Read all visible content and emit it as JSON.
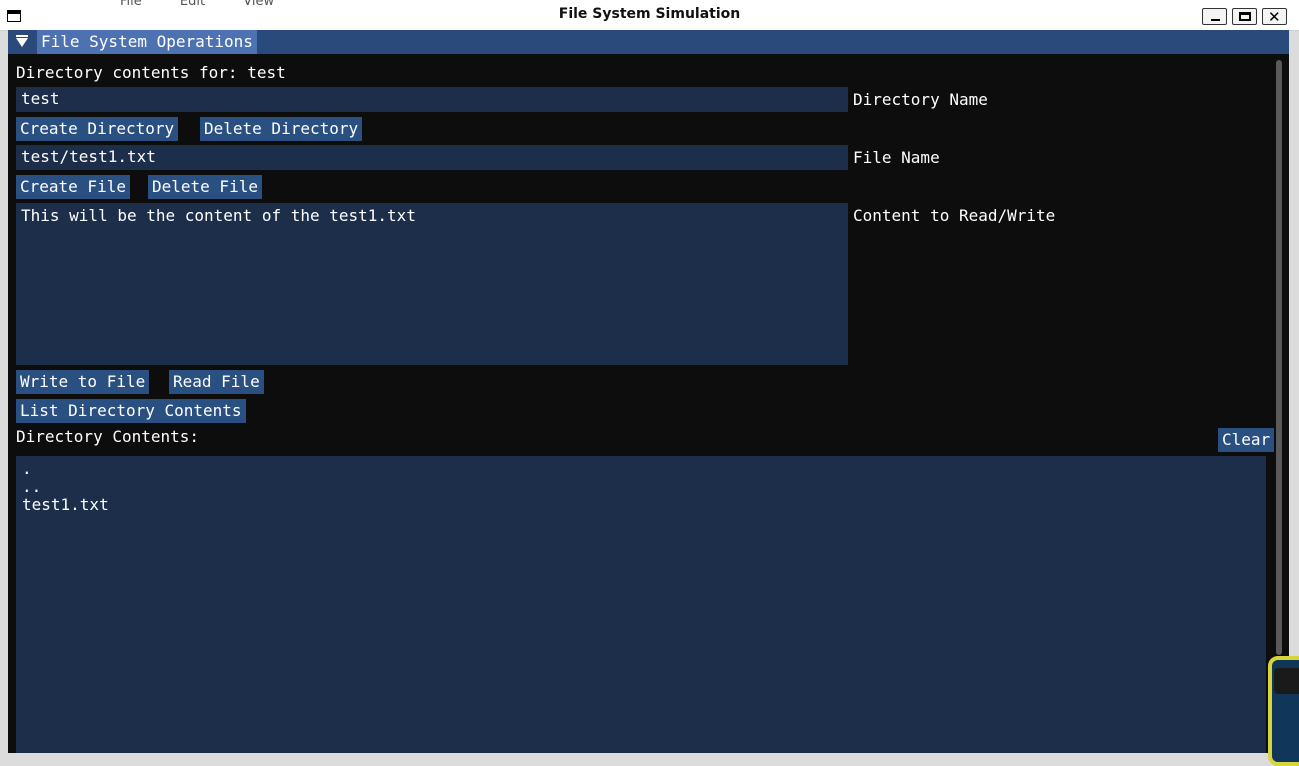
{
  "window": {
    "title": "File System Simulation",
    "background_menu": [
      "File",
      "Edit",
      "View"
    ]
  },
  "panel": {
    "header": "File System Operations"
  },
  "directory_label": "Directory contents for: test",
  "directory_input": {
    "value": "test",
    "label": "Directory Name"
  },
  "directory_buttons": {
    "create": "Create Directory",
    "delete": "Delete Directory"
  },
  "file_input": {
    "value": "test/test1.txt",
    "label": "File Name"
  },
  "file_buttons": {
    "create": "Create File",
    "delete": "Delete File"
  },
  "content_input": {
    "value": "This will be the content of the test1.txt",
    "label": "Content to Read/Write"
  },
  "io_buttons": {
    "write": "Write to File",
    "read": "Read File"
  },
  "list_button": "List Directory Contents",
  "contents_label": "Directory Contents:",
  "clear_button": "Clear",
  "contents_lines": [
    ".",
    "..",
    "test1.txt"
  ],
  "colors": {
    "header_bg": "#294a7a",
    "header_label_bg": "#4d72b2",
    "frame_bg": "#1d2e4b",
    "button_bg": "#2a5082",
    "window_bg": "#0d0d0d"
  },
  "icons": {
    "window": "app-window-icon",
    "minimize": "minimize-icon",
    "maximize": "maximize-icon",
    "close": "close-icon",
    "collapse": "collapse-arrow-icon"
  }
}
